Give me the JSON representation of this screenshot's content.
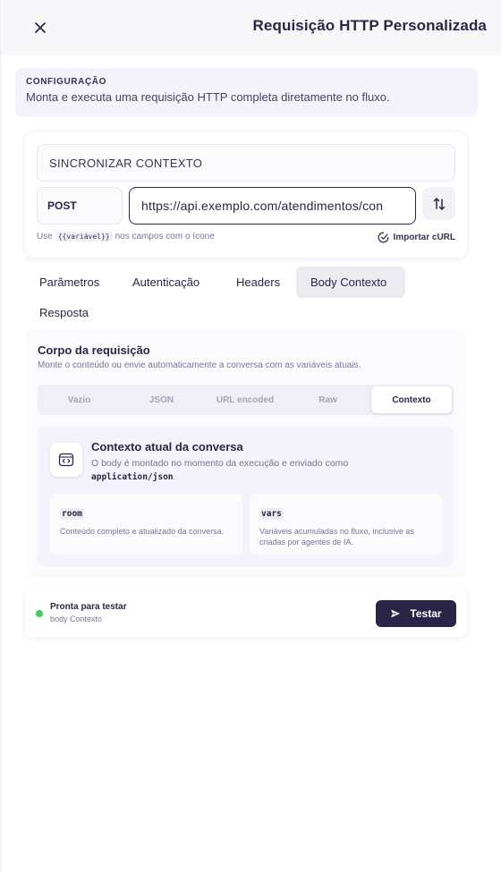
{
  "header": {
    "title": "Requisição HTTP Personalizada",
    "close_icon": "close-icon"
  },
  "config": {
    "label": "CONFIGURAÇÃO",
    "description": "Monta e executa uma requisição HTTP completa diretamente no fluxo."
  },
  "request": {
    "name": "SINCRONIZAR CONTEXTO",
    "method": "POST",
    "url": "https://api.exemplo.com/atendimentos/con",
    "hint_prefix": "Use",
    "hint_code": "{{variável}}",
    "hint_suffix": "nos campos com o ícone",
    "import_curl": "Importar cURL",
    "swap_icon": "swap-icon"
  },
  "tabs": [
    {
      "label": "Parâmetros"
    },
    {
      "label": "Autenticação"
    },
    {
      "label": "Headers"
    },
    {
      "label": "Body Contexto",
      "active": true
    },
    {
      "label": "Resposta"
    }
  ],
  "body": {
    "title": "Corpo da requisição",
    "subtitle": "Monte o conteúdo ou envie automaticamente a conversa com as variáveis atuais.",
    "modes": [
      "Vazio",
      "JSON",
      "URL encoded",
      "Raw",
      "Contexto"
    ],
    "active_mode": "Contexto",
    "context": {
      "title": "Contexto atual da conversa",
      "desc_text": "O body é montado no momento da execução e enviado como",
      "desc_code": "application/json",
      "desc_end": ".",
      "vars": [
        {
          "name": "room",
          "desc": "Conteúdo completo e atualizado da conversa."
        },
        {
          "name": "vars",
          "desc": "Variáveis acumuladas no fluxo, inclusive as criadas por agentes de IA."
        }
      ]
    }
  },
  "footer": {
    "status": "Pronta para testar",
    "sub": "body Contexto",
    "status_color": "#3fcf5a",
    "test_label": "Testar"
  },
  "colors": {
    "accent": "#2b2447",
    "active_tab_bg": "#ecebf1"
  }
}
